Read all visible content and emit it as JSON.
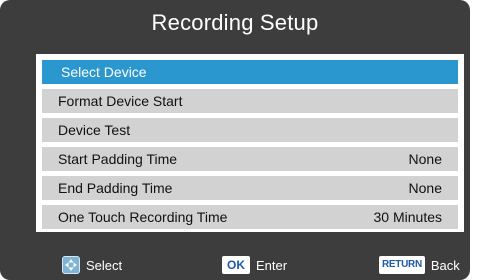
{
  "title": "Recording Setup",
  "menu": {
    "items": [
      {
        "label": "Select Device",
        "value": ""
      },
      {
        "label": "Format Device Start",
        "value": ""
      },
      {
        "label": "Device Test",
        "value": ""
      },
      {
        "label": "Start Padding Time",
        "value": "None"
      },
      {
        "label": "End Padding Time",
        "value": "None"
      },
      {
        "label": "One Touch Recording Time",
        "value": "30 Minutes"
      }
    ],
    "selected_index": 0
  },
  "footer": {
    "select": {
      "icon": "directional-pad-icon",
      "label": "Select"
    },
    "enter": {
      "key": "OK",
      "label": "Enter"
    },
    "back": {
      "key": "RETURN",
      "label": "Back"
    }
  },
  "colors": {
    "background": "#3d3d3d",
    "row": "#d2d2d2",
    "highlight": "#2b97cf"
  }
}
